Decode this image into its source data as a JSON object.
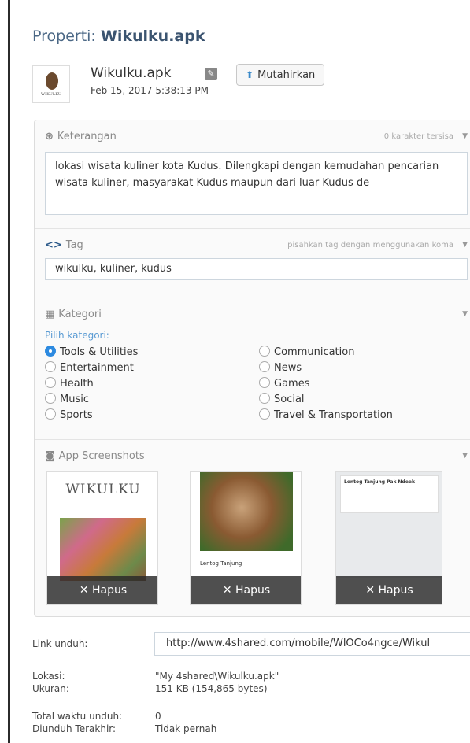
{
  "page": {
    "title_prefix": "Properti:",
    "title_name": "Wikulku.apk"
  },
  "file": {
    "thumb_text": "WIKULKU",
    "name": "Wikulku.apk",
    "date": "Feb 15, 2017 5:38:13 PM",
    "update_label": "Mutahirkan"
  },
  "description": {
    "label": "Keterangan",
    "hint": "0 karakter tersisa",
    "value": "lokasi wisata kuliner kota Kudus. Dilengkapi dengan kemudahan pencarian wisata kuliner, masyarakat Kudus maupun dari luar Kudus de"
  },
  "tags": {
    "label": "Tag",
    "hint": "pisahkan tag dengan menggunakan koma",
    "value": "wikulku, kuliner, kudus"
  },
  "category": {
    "label": "Kategori",
    "sublabel": "Pilih kategori:",
    "left": [
      "Tools & Utilities",
      "Entertainment",
      "Health",
      "Music",
      "Sports"
    ],
    "right": [
      "Communication",
      "News",
      "Games",
      "Social",
      "Travel & Transportation"
    ],
    "selected": "Tools & Utilities"
  },
  "screenshots": {
    "label": "App Screenshots",
    "shot1_title": "WIKULKU",
    "shot2_caption": "Lentog Tanjung",
    "shot3_title": "Lentog Tanjung Pak Ndeek",
    "delete_label": "Hapus"
  },
  "details": {
    "link_label": "Link unduh:",
    "link_value": "http://www.4shared.com/mobile/WlOCo4ngce/Wikul",
    "location_label": "Lokasi:",
    "location_value": "\"My 4shared\\Wikulku.apk\"",
    "size_label": "Ukuran:",
    "size_value": "151 KB (154,865 bytes)",
    "downloads_label": "Total waktu unduh:",
    "downloads_value": "0",
    "last_download_label": "Diunduh Terakhir:",
    "last_download_value": "Tidak pernah"
  },
  "colors": {
    "accent": "#2d8ae0",
    "title": "#3b5470",
    "sublabel": "#5a9bd3"
  }
}
